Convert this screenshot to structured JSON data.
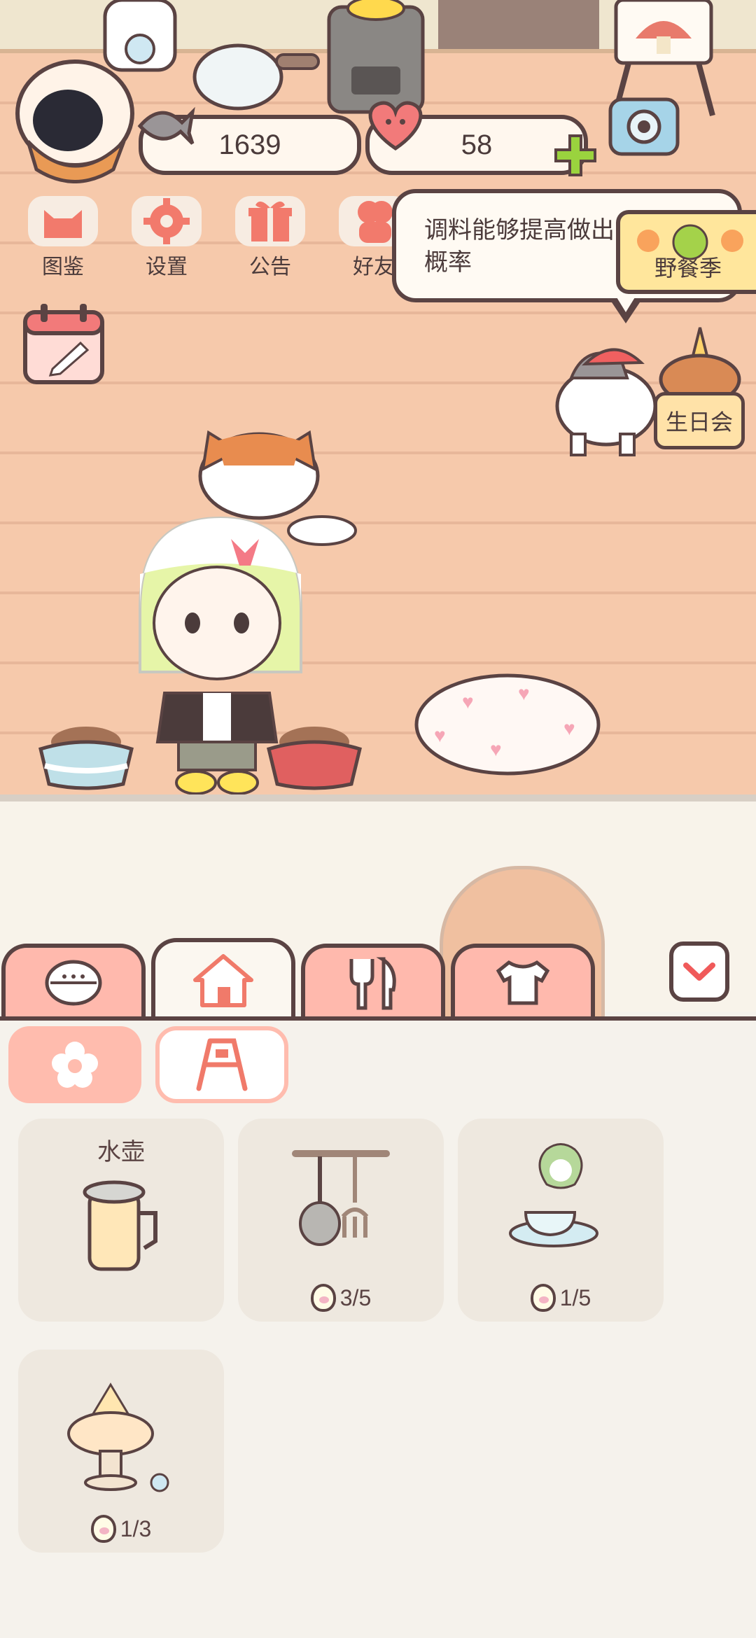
{
  "hud": {
    "fish_count": "1639",
    "heart_count": "58"
  },
  "menu": [
    {
      "label": "图鉴",
      "icon": "cat-face-icon"
    },
    {
      "label": "设置",
      "icon": "gear-icon"
    },
    {
      "label": "公告",
      "icon": "gift-icon"
    },
    {
      "label": "好友",
      "icon": "friends-icon"
    }
  ],
  "speech": {
    "line1": "调料能够提高做出",
    "line2": "概率"
  },
  "events": {
    "picnic": "野餐季",
    "birthday": "生日会"
  },
  "tabs": [
    {
      "icon": "face-icon",
      "active": false
    },
    {
      "icon": "house-icon",
      "active": true
    },
    {
      "icon": "utensils-icon",
      "active": false
    },
    {
      "icon": "shirt-icon",
      "active": false
    }
  ],
  "subtabs": [
    {
      "icon": "flower-icon",
      "active": true
    },
    {
      "icon": "sign-board-icon",
      "active": false
    }
  ],
  "items": [
    {
      "title": "水壶",
      "count": "",
      "icon": "kettle-icon"
    },
    {
      "title": "",
      "count": "3/5",
      "icon": "hanging-utensils-icon"
    },
    {
      "title": "",
      "count": "1/5",
      "icon": "teacup-plant-icon"
    },
    {
      "title": "",
      "count": "1/3",
      "icon": "cake-stand-icon"
    }
  ],
  "colors": {
    "accent": "#ffb9ad",
    "outline": "#5a4343",
    "wall": "#f6c9ab",
    "panel": "#f5f2ec"
  }
}
